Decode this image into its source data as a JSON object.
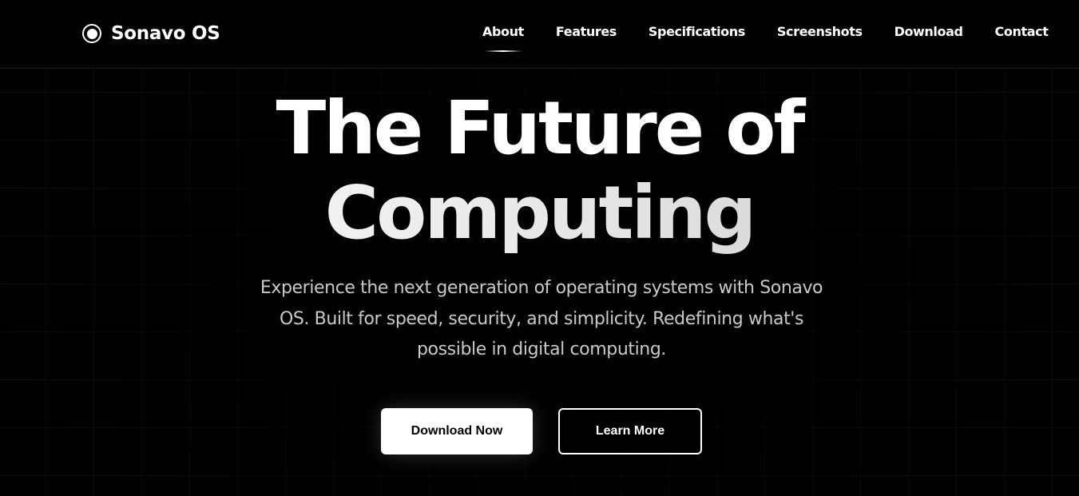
{
  "brand": {
    "name": "Sonavo OS",
    "icon": "circle-dot-icon"
  },
  "nav": {
    "items": [
      {
        "label": "About",
        "active": true
      },
      {
        "label": "Features",
        "active": false
      },
      {
        "label": "Specifications",
        "active": false
      },
      {
        "label": "Screenshots",
        "active": false
      },
      {
        "label": "Download",
        "active": false
      },
      {
        "label": "Contact",
        "active": false
      }
    ]
  },
  "hero": {
    "title_line1": "The Future of",
    "title_line2": "Computing",
    "subtitle": "Experience the next generation of operating systems with Sonavo OS. Built for speed, security, and simplicity. Redefining what's possible in digital computing.",
    "primary_button": "Download Now",
    "secondary_button": "Learn More"
  },
  "colors": {
    "background": "#000000",
    "text": "#ffffff",
    "subtitle": "#c9c9c9",
    "primary_button_bg": "#ffffff",
    "primary_button_text": "#000000"
  }
}
